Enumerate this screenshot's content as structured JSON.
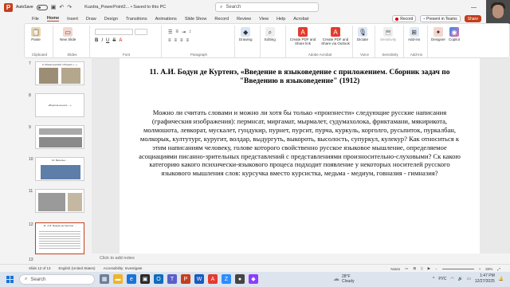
{
  "titlebar": {
    "autosave_label": "AutoSave",
    "doc_title": "Kuzdra_PowerPoint2... • Saved to this PC",
    "search_placeholder": "Search"
  },
  "menu": {
    "tabs": [
      "File",
      "Home",
      "Insert",
      "Draw",
      "Design",
      "Transitions",
      "Animations",
      "Slide Show",
      "Record",
      "Review",
      "View",
      "Help",
      "Acrobat"
    ],
    "record_label": "Record",
    "present_label": "Present in Teams",
    "share_label": "Share"
  },
  "ribbon": {
    "paste": "Paste",
    "new_slide": "New Slide",
    "clipboard_group": "Clipboard",
    "slides_group": "Slides",
    "font_group": "Font",
    "paragraph_group": "Paragraph",
    "drawing": "Drawing",
    "editing": "Editing",
    "create_pdf": "Create PDF and Share link",
    "create_pdf_outlook": "Create PDF and Share via Outlook",
    "adobe_group": "Adobe Acrobat",
    "dictate": "Dictate",
    "voice_group": "Voice",
    "sensitivity": "Sensitivity",
    "sensitivity_group": "Sensitivity",
    "addins": "Add-ins",
    "addins_group": "Add-ins",
    "designer": "Designer",
    "copilot": "Copilot"
  },
  "thumbnails": [
    {
      "num": "7",
      "title": "9. Монастырский. Сборник «...»",
      "selected": false
    },
    {
      "num": "8",
      "title": "«Ворогов на нить ...»",
      "selected": false
    },
    {
      "num": "9",
      "title": "",
      "selected": false
    },
    {
      "num": "10",
      "title": "10. Веселье ...",
      "selected": false
    },
    {
      "num": "11",
      "title": "",
      "selected": false
    },
    {
      "num": "12",
      "title": "11. А.И. Бодуэн де Куртенэ ...",
      "selected": true
    },
    {
      "num": "13",
      "title": "",
      "selected": false
    }
  ],
  "slide": {
    "title": "11. А.И. Бодун де Куртенэ, «Введение в языковедение с приложением. Сборник задач по \"Введению в языковедение\" (1912)",
    "body": "Можно ли считать словами и можно ли хотя бы только «произнести» следующие русские написания (графическия изображения): пермнсат, миргамат, мырмалет, судумахолока, фриктамани, мякирикота, молмошота, левкорат, мускалет, гундукир, пурнет, пурсит, пурча, куркуль, корголго, русьпиток, пуркалбан, молкорык, култутург, куругит, волдар, выдургуть, выкороть, высолость, супуркул, кулекур? Как относиться к этим написаниям человеку, голове которого свойственно русское языковое мышление, определяемое асоциациями писанно-зрительных представлений с представлениями произносительно-слуховыми? Ск какою категорию какого психически-языкового процеса подходит появление у некоторых носителей русского языкового мышления слов: курсучка вместо курсистка, медьма - медиум, говназия - гимназия?"
  },
  "notes_placeholder": "Click to add notes",
  "status": {
    "slide_count": "Slide 12 of 13",
    "language": "English (United States)",
    "accessibility": "Accessibility: Investigate",
    "notes": "Notes",
    "zoom": "83%"
  },
  "taskbar": {
    "search_placeholder": "Search",
    "weather_temp": "28°F",
    "weather_desc": "Cloudy",
    "lang": "РУС",
    "time": "1:47 PM",
    "date": "12/27/2025"
  },
  "colors": {
    "accent": "#c43e1c",
    "taskbar": "#dde4ee"
  }
}
